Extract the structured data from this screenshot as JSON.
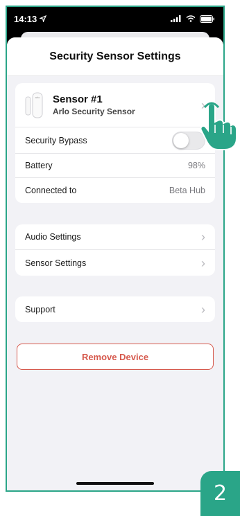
{
  "status_bar": {
    "time": "14:13"
  },
  "header": {
    "title": "Security Sensor Settings"
  },
  "device": {
    "name": "Sensor #1",
    "model": "Arlo Security Sensor",
    "image_brand_mark": "arlo"
  },
  "device_details": [
    {
      "label": "Security Bypass",
      "type": "toggle",
      "on": false
    },
    {
      "label": "Battery",
      "value": "98%"
    },
    {
      "label": "Connected to",
      "value": "Beta Hub"
    }
  ],
  "settings_group": [
    {
      "label": "Audio Settings"
    },
    {
      "label": "Sensor Settings"
    }
  ],
  "support_group": [
    {
      "label": "Support"
    }
  ],
  "remove_button": {
    "label": "Remove Device"
  },
  "step_badge": {
    "number": "2"
  },
  "colors": {
    "accent": "#2aa588",
    "danger": "#d6594d"
  },
  "icons": [
    "location-arrow-icon",
    "cellular-signal-icon",
    "wifi-icon",
    "battery-icon",
    "chevron-right-icon",
    "tap-hand-icon"
  ]
}
